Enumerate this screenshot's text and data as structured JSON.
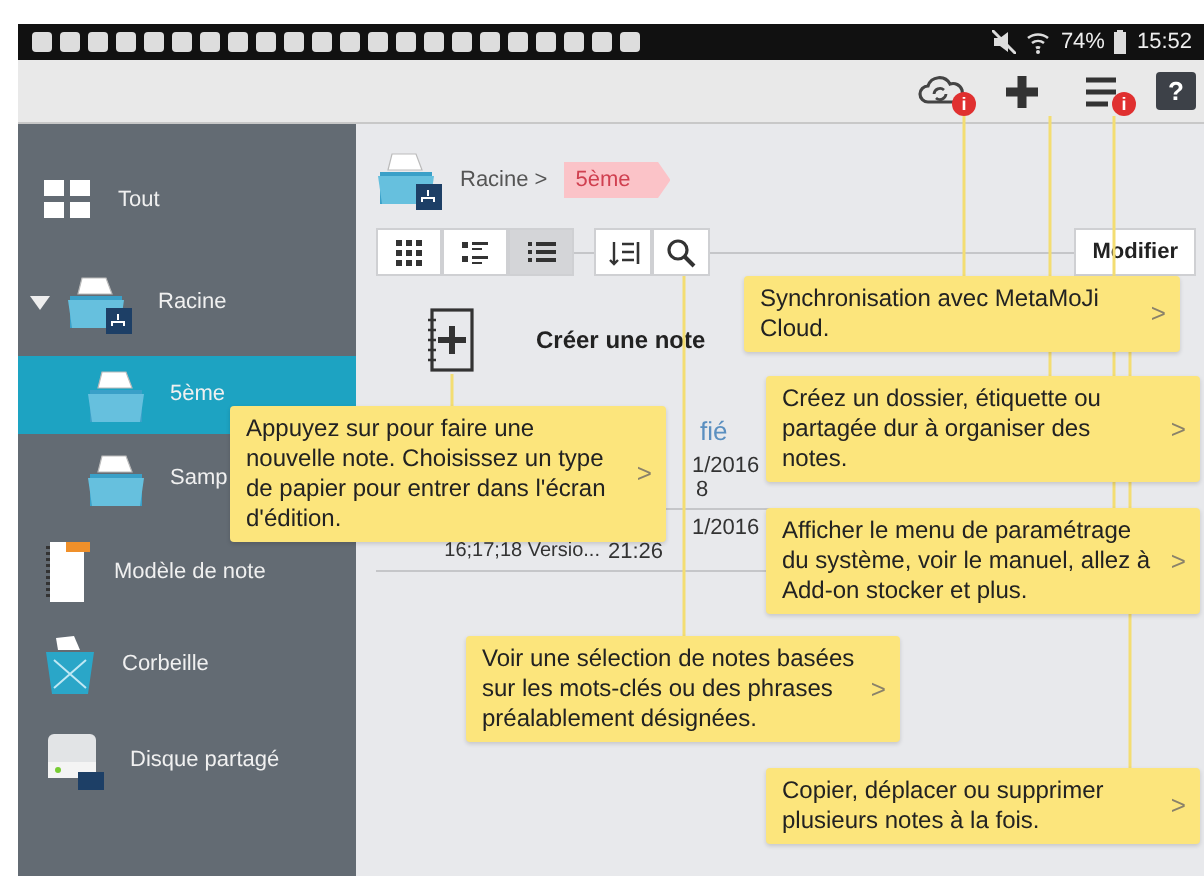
{
  "status_bar": {
    "battery": "74%",
    "time": "15:52"
  },
  "toolbar": {
    "buttons": [
      {
        "kind": "sync",
        "badge": "i"
      },
      {
        "kind": "add"
      },
      {
        "kind": "menu",
        "badge": "i"
      },
      {
        "kind": "help",
        "label": "?"
      }
    ]
  },
  "sidebar": {
    "items": [
      {
        "label": "Tout",
        "kind": "all",
        "selected": false
      },
      {
        "label": "Racine",
        "kind": "root",
        "selected": false,
        "expanded": true,
        "children": [
          {
            "label": "5ème",
            "kind": "folder",
            "selected": true
          },
          {
            "label": "Samp",
            "kind": "folder",
            "selected": false
          }
        ]
      },
      {
        "label": "Modèle de note",
        "kind": "template",
        "selected": false
      },
      {
        "label": "Corbeille",
        "kind": "trash",
        "selected": false
      },
      {
        "label": "Disque partagé",
        "kind": "shared",
        "selected": false
      }
    ]
  },
  "breadcrumb": {
    "path": "Racine >",
    "current": "5ème"
  },
  "view_buttons": [
    {
      "kind": "grid",
      "selected": false
    },
    {
      "kind": "detail",
      "selected": false
    },
    {
      "kind": "list",
      "selected": true
    }
  ],
  "tools": [
    {
      "kind": "sort"
    },
    {
      "kind": "search"
    }
  ],
  "edit_button": "Modifier",
  "create_note": "Créer une note",
  "list": {
    "header": "fié",
    "rows": [
      {
        "name": "",
        "date": "1/2016",
        "time": "8"
      },
      {
        "name": "16;17;18 Versio...",
        "date": "1/2016",
        "time": "21:26"
      }
    ]
  },
  "tooltips": [
    {
      "text": "Appuyez sur pour faire une nouvelle note. Choisissez un type de papier pour entrer dans l'écran d'édition.",
      "chevron": ">"
    },
    {
      "text": "Synchronisation avec MetaMoJi Cloud.",
      "chevron": ">"
    },
    {
      "text": "Créez un dossier, étiquette ou partagée dur à organiser des notes.",
      "chevron": ">"
    },
    {
      "text": "Afficher le menu de paramétrage du système, voir le manuel, allez à Add-on stocker et plus.",
      "chevron": ">"
    },
    {
      "text": "Voir une sélection de notes basées sur les mots-clés ou des phrases préalablement désignées.",
      "chevron": ">"
    },
    {
      "text": "Copier, déplacer ou supprimer plusieurs notes à la fois.",
      "chevron": ">"
    }
  ]
}
